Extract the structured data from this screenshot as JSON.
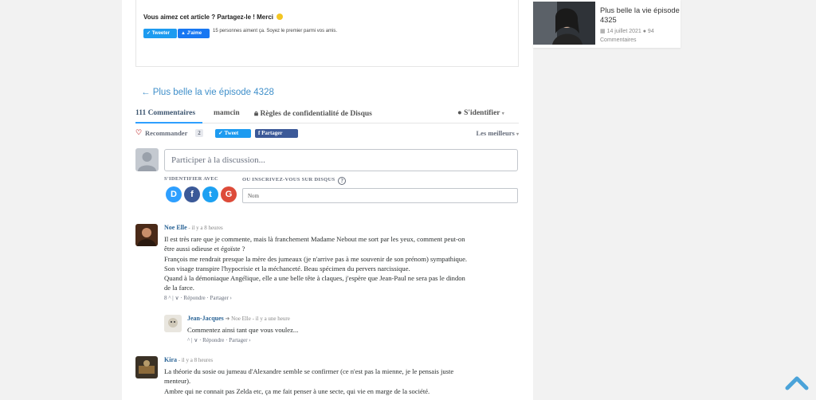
{
  "share": {
    "title": "Vous aimez cet article ? Partagez-le ! Merci",
    "tweet_label": "Tweeter",
    "like_label": "J'aime",
    "like_text": "15 personnes aiment ça. Soyez le premier parmi vos amis."
  },
  "prev_link": "← Plus belle la vie épisode 4328",
  "disqus": {
    "tabs": {
      "comments": "111 Commentaires",
      "site": "mamcin",
      "privacy": "Règles de confidentialité de Disqus",
      "login": "S'identifier"
    },
    "toolbar": {
      "recommend": "Recommander",
      "recommend_count": "2",
      "tweet": "Tweet",
      "share": "Partager",
      "sort": "Les meilleurs"
    },
    "compose": {
      "placeholder": "Participer à la discussion...",
      "signin_with": "S'IDENTIFIER AVEC",
      "signup_label": "OU INSCRIVEZ-VOUS SUR DISQUS",
      "name_placeholder": "Nom",
      "social": [
        {
          "letter": "D",
          "color": "#2e9fff",
          "icon": "disqus-icon"
        },
        {
          "letter": "f",
          "color": "#3b5998",
          "icon": "facebook-icon"
        },
        {
          "letter": "t",
          "color": "#1da1f2",
          "icon": "twitter-icon"
        },
        {
          "letter": "G",
          "color": "#dd4b39",
          "icon": "google-icon"
        }
      ]
    },
    "comments": [
      {
        "author": "Noe Elle",
        "time": "- il y a 8 heures",
        "lines": [
          "Il est très rare que je commente, mais là franchement Madame Nebout me sort par les yeux, comment peut-on",
          "être aussi odieuse et égoïste ?",
          "François me rendrait presque la mère des jumeaux (je n'arrive pas à me souvenir de son prénom) sympathique.",
          "Son visage transpire l'hypocrisie et la méchanceté. Beau spécimen du pervers narcissique.",
          "Quand à la démoniaque Angélique, elle a une belle tête à claques, j'espère que Jean-Paul ne sera pas le dindon",
          "de la farce."
        ],
        "votes": "8",
        "reply": "Répondre",
        "share": "Partager ›"
      },
      {
        "author": "Jean-Jacques",
        "reply_to": "Noe Elle",
        "time": "- il y a une heure",
        "lines": [
          "Commentez ainsi tant que vous voulez..."
        ],
        "reply": "Répondre",
        "share": "Partager ›"
      },
      {
        "author": "Kira",
        "time": "- il y a 8 heures",
        "lines": [
          "La théorie du sosie ou jumeau d'Alexandre semble se confirmer (ce n'est pas la mienne, je le pensais juste",
          "menteur).",
          "Ambre qui ne connait pas Zelda etc, ça me fait penser à une secte, qui vie en marge de la société."
        ]
      }
    ]
  },
  "related": {
    "title": "Plus belle la vie épisode 4325",
    "date": "14 juillet 2021",
    "comments_count": "94",
    "comments_label": "Commentaires"
  },
  "colors": {
    "link": "#3f8fca",
    "tab_active": "#2e9fff",
    "author": "#2a6496"
  }
}
